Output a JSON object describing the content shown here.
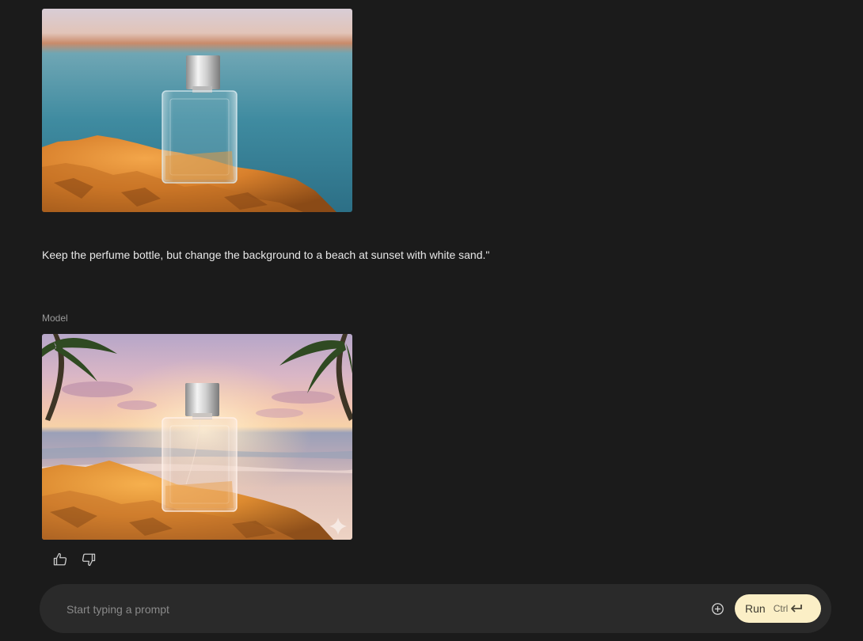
{
  "conversation": {
    "user_turn": {
      "image": {
        "description_icon": "perfume-bottle-on-rock-lake-photo"
      },
      "prompt_text": "Keep the perfume bottle, but change the background to a beach at sunset with white sand.\""
    },
    "model_turn": {
      "role_label": "Model",
      "image": {
        "description_icon": "perfume-bottle-beach-sunset-photo"
      },
      "feedback": {
        "like_icon": "thumb-up-icon",
        "dislike_icon": "thumb-down-icon"
      }
    }
  },
  "prompt_bar": {
    "placeholder": "Start typing a prompt",
    "value": "",
    "add_icon": "add-circle-icon",
    "run_label": "Run",
    "run_shortcut": "Ctrl",
    "run_shortcut_icon": "enter-icon"
  },
  "colors": {
    "background": "#1b1b1b",
    "prompt_bar": "#2a2a2a",
    "run_button": "#fbefc6"
  }
}
